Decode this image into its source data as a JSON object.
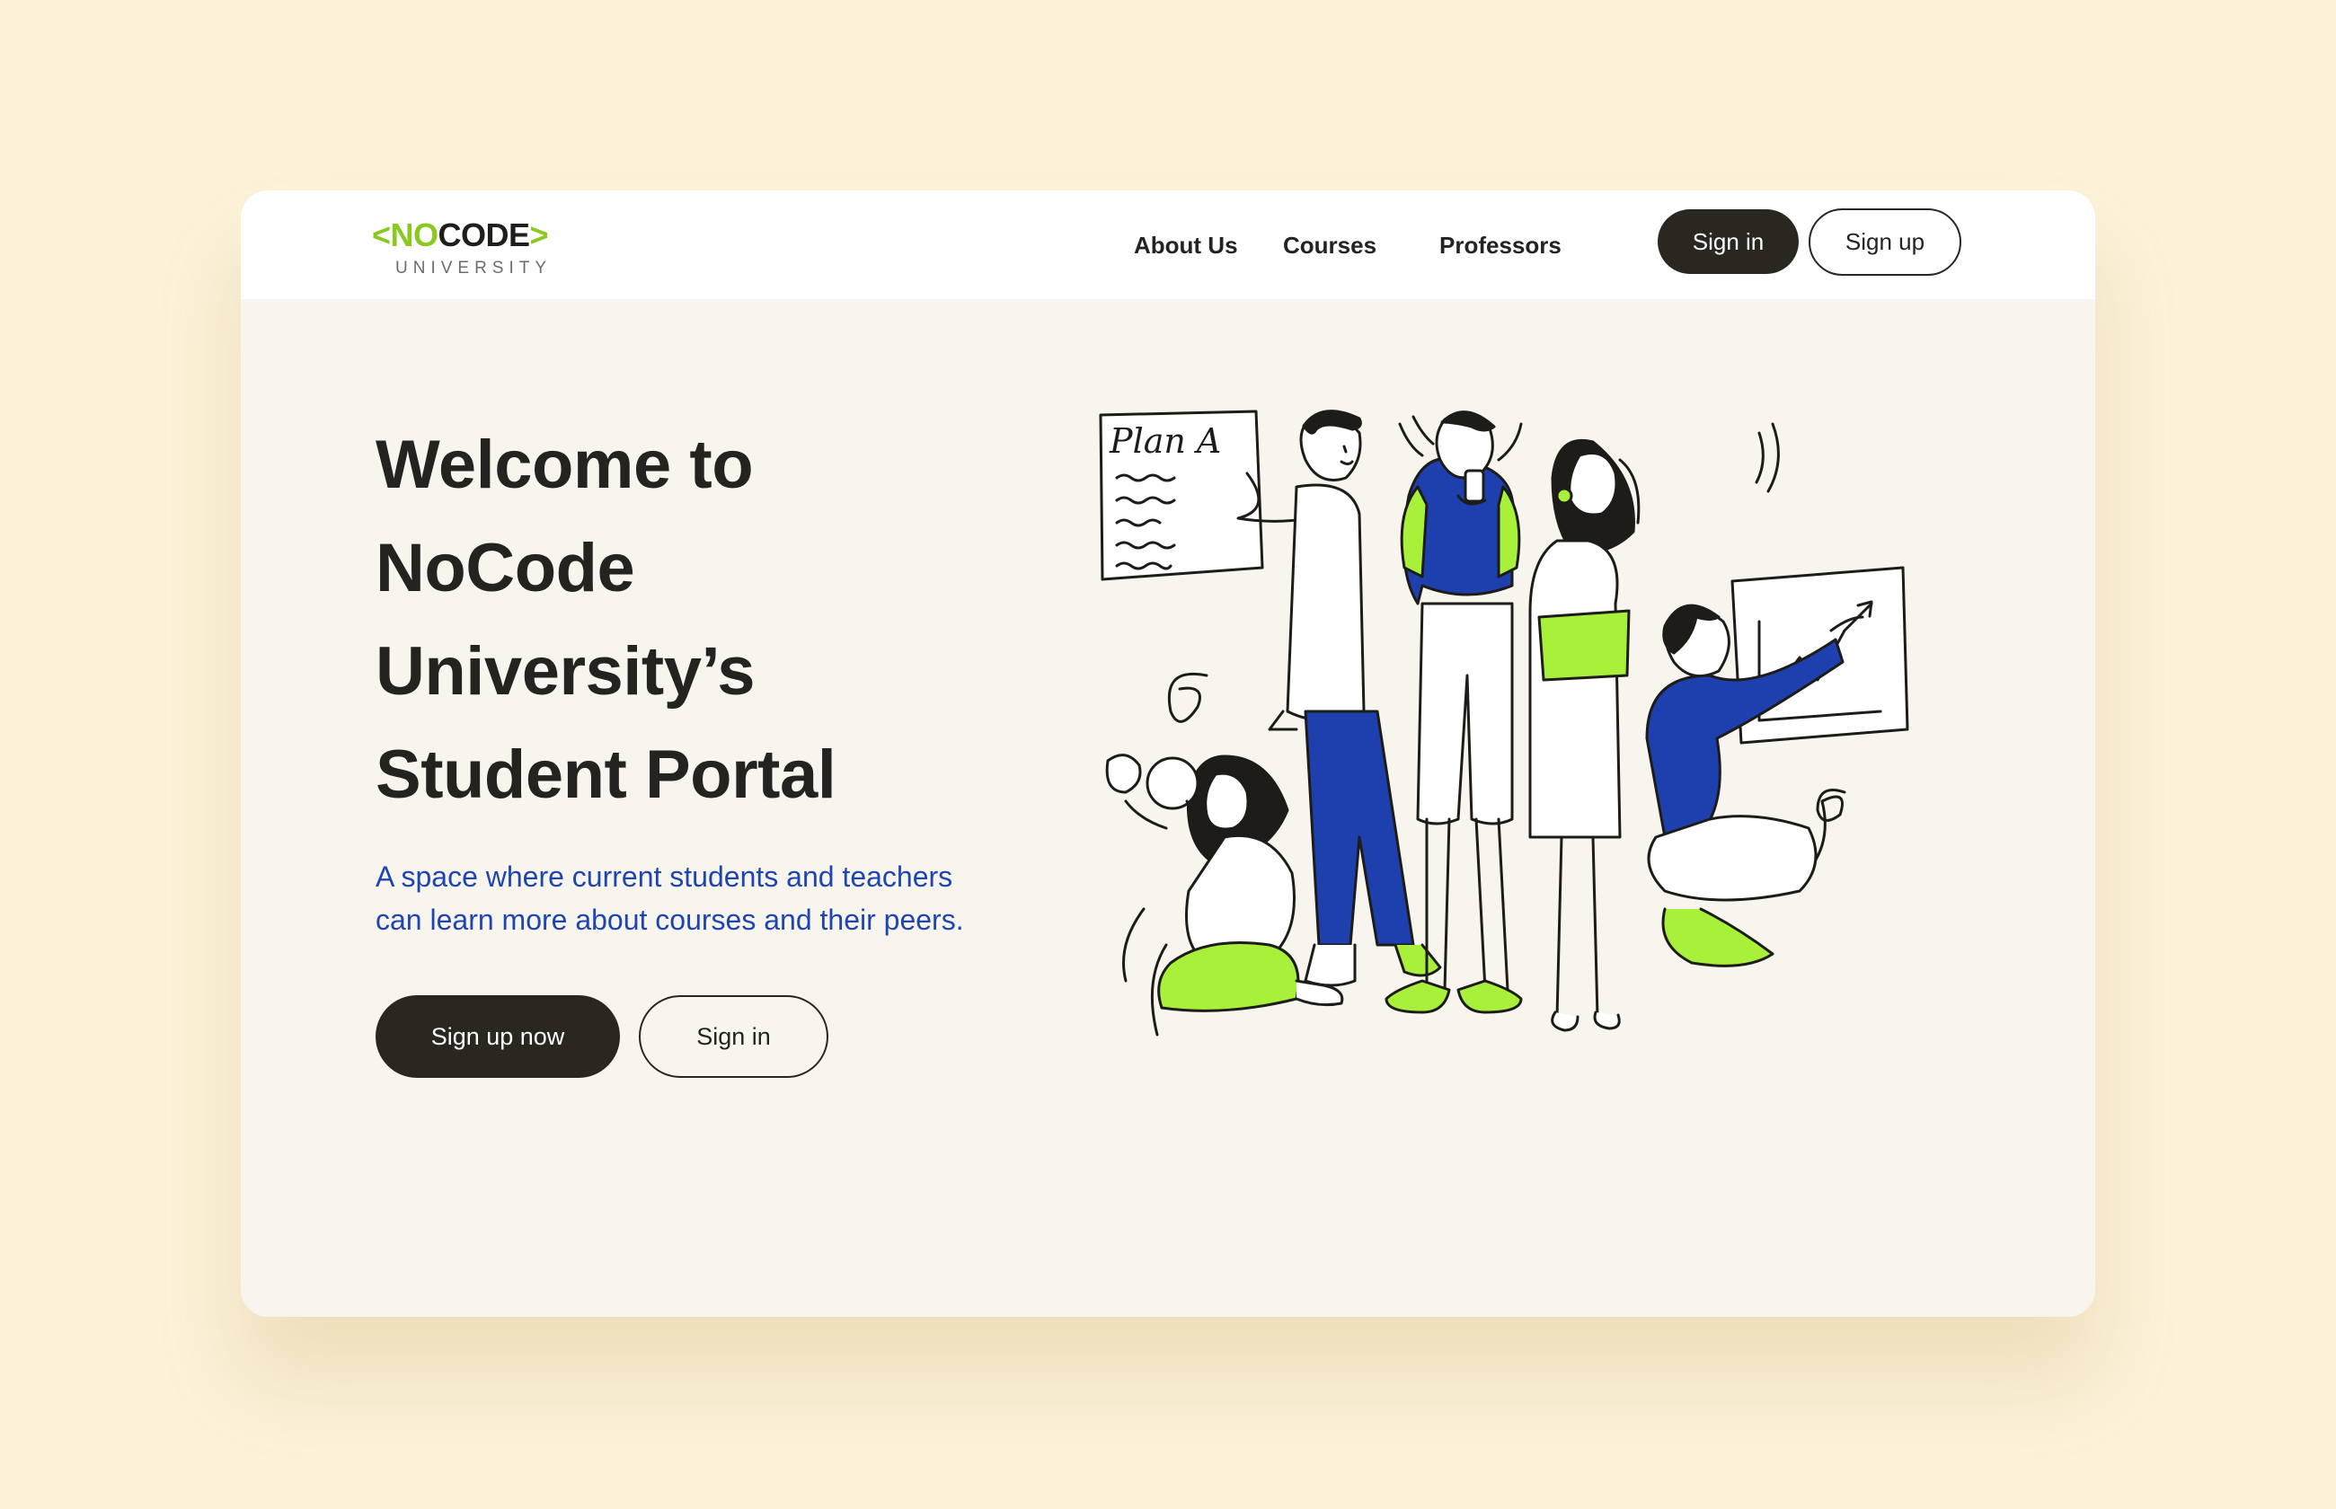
{
  "colors": {
    "page_background": "#fcf2d8",
    "card_background": "#f8f5ee",
    "accent_green": "#8ac91f",
    "illustration_green": "#a8f03a",
    "accent_blue": "#1f46b0",
    "dark": "#2a2620"
  },
  "logo": {
    "bracket_left": "<",
    "word_no": "NO",
    "word_code": "CODE",
    "bracket_right": ">",
    "subtitle": "UNIVERSITY"
  },
  "nav": {
    "links": [
      {
        "label": "About Us"
      },
      {
        "label": "Courses"
      },
      {
        "label": "Professors"
      }
    ],
    "signin_label": "Sign in",
    "signup_label": "Sign up"
  },
  "hero": {
    "title_lines": [
      "Welcome to",
      "NoCode",
      "University’s",
      "Student Portal"
    ],
    "subtitle_lines": [
      "A space where current students and teachers",
      "can learn more about courses and their peers."
    ],
    "primary_button": "Sign up now",
    "secondary_button": "Sign in"
  },
  "illustration": {
    "whiteboard_text": "Plan A"
  }
}
